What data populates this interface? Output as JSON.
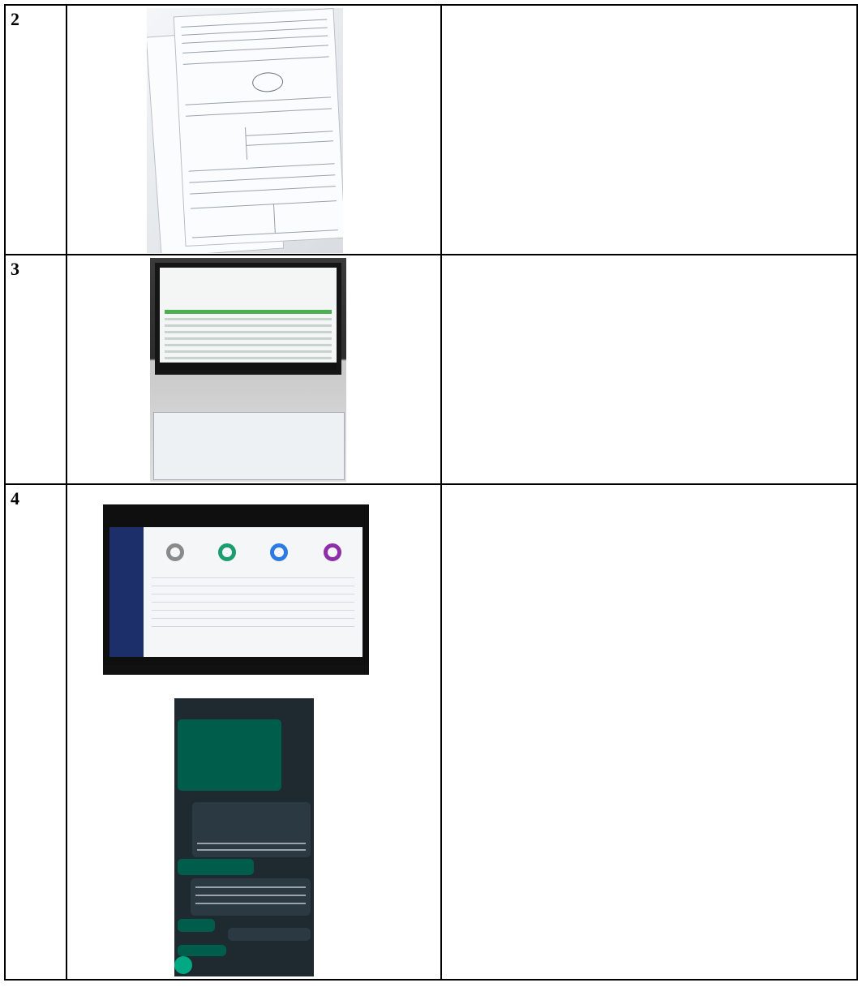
{
  "rows": [
    {
      "number": "2"
    },
    {
      "number": "3"
    },
    {
      "number": "4"
    }
  ]
}
